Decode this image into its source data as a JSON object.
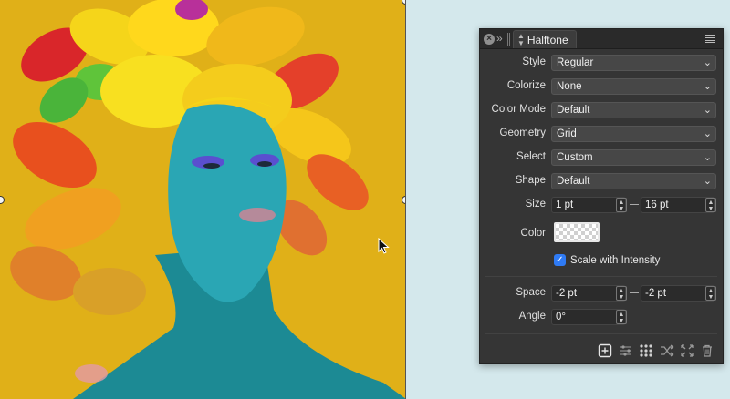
{
  "panel": {
    "title": "Halftone",
    "close_glyph": "×",
    "collapse_glyph": "»",
    "fields": {
      "style": {
        "label": "Style",
        "value": "Regular"
      },
      "colorize": {
        "label": "Colorize",
        "value": "None"
      },
      "color_mode": {
        "label": "Color Mode",
        "value": "Default"
      },
      "geometry": {
        "label": "Geometry",
        "value": "Grid"
      },
      "select": {
        "label": "Select",
        "value": "Custom"
      },
      "shape": {
        "label": "Shape",
        "value": "Default"
      }
    },
    "size": {
      "label": "Size",
      "min": "1 pt",
      "max": "16 pt"
    },
    "color": {
      "label": "Color"
    },
    "scale_with_intensity": {
      "label": "Scale with Intensity",
      "checked": true
    },
    "space": {
      "label": "Space",
      "x": "-2 pt",
      "y": "-2 pt"
    },
    "angle": {
      "label": "Angle",
      "value": "0°"
    },
    "footer_icons": [
      "add-icon",
      "sliders-icon",
      "grid-dots-icon",
      "shuffle-icon",
      "expand-icon",
      "trash-icon"
    ]
  },
  "canvas": {
    "background_color": "#e0b018",
    "skin_color": "#2aa6b4",
    "cursor": "arrow-cursor-icon"
  },
  "colors": {
    "panel_bg": "#353535",
    "accent": "#2f7bf5",
    "desktop_bg": "#d4e8ec"
  }
}
